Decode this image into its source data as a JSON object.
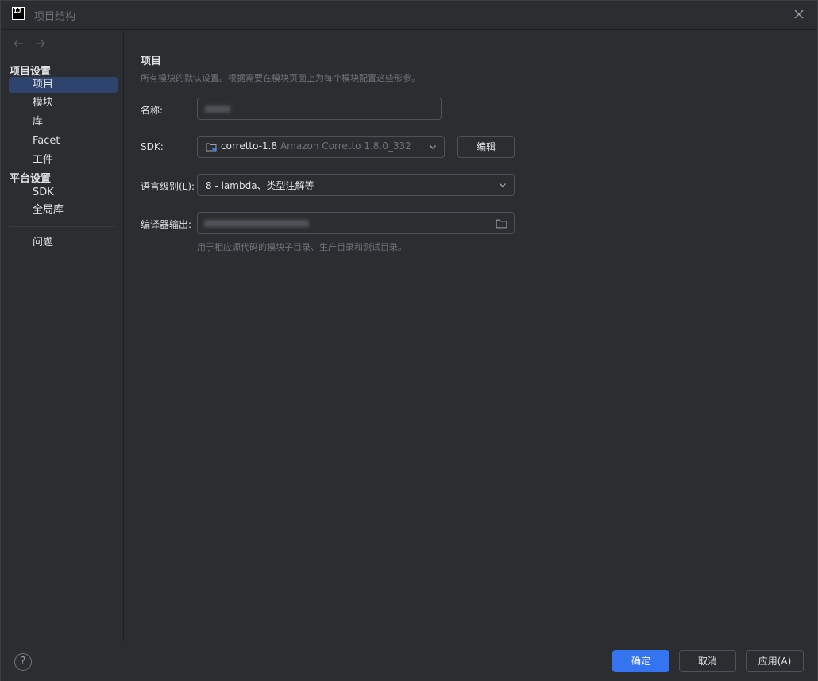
{
  "window": {
    "title": "项目结构",
    "close_icon": "close-icon",
    "app_icon": "intellij-idea-icon"
  },
  "nav": {
    "back_icon": "arrow-left-icon",
    "forward_icon": "arrow-right-icon"
  },
  "sidebar": {
    "section1": "项目设置",
    "items1": [
      {
        "label": "项目",
        "selected": true
      },
      {
        "label": "模块"
      },
      {
        "label": "库"
      },
      {
        "label": "Facet"
      },
      {
        "label": "工件"
      }
    ],
    "section2": "平台设置",
    "items2": [
      {
        "label": "SDK"
      },
      {
        "label": "全局库"
      }
    ],
    "items3": [
      {
        "label": "问题"
      }
    ]
  },
  "main": {
    "title": "项目",
    "description": "所有模块的默认设置。根据需要在模块页面上为每个模块配置这些形参。",
    "name_label": "名称:",
    "sdk_label": "SDK:",
    "sdk_value": "corretto-1.8",
    "sdk_detail": "Amazon Corretto 1.8.0_332",
    "edit_button": "编辑",
    "lang_label": "语言级别(L):",
    "lang_value": "8 - lambda、类型注解等",
    "compiler_label": "编译器输出:",
    "compiler_hint": "用于相应源代码的模块子目录、生产目录和测试目录。"
  },
  "footer": {
    "help_label": "?",
    "ok_button": "确定",
    "cancel_button": "取消",
    "apply_button": "应用(A)"
  },
  "colors": {
    "accent": "#3574f0",
    "selection": "#2e436e",
    "background": "#2b2d30"
  }
}
